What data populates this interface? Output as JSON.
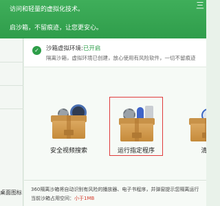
{
  "banner": {
    "line1": "访问和轻量的虚拟化技术。",
    "line2": "启沙箱，不留痕迹，让您更安心。",
    "glyph": "三"
  },
  "sidebar": {
    "label": "桌面图标"
  },
  "status": {
    "title_prefix": "沙箱虚拟环境:",
    "title_state": "已开启",
    "desc": "隔离沙箱，虚拟环境已创建，放心使用有风险软件，一切不留痕迹"
  },
  "cards": [
    {
      "label": "安全视频搜索",
      "icon": "video-box-icon"
    },
    {
      "label": "运行指定程序",
      "icon": "program-box-icon"
    },
    {
      "label": "清理沙",
      "icon": "clean-box-icon"
    }
  ],
  "footer": {
    "line1": "360隔离沙箱将自动识别有风险的播放器、电子书程序，并弹窗提示您隔离运行",
    "line2_prefix": "当前沙箱占用空间：",
    "line2_value": "小于1MB"
  },
  "colors": {
    "banner_green": "#2f9d4b",
    "status_green": "#2e9e49",
    "highlight_red": "#d43a2a",
    "selection_border": "#e03a3a"
  }
}
